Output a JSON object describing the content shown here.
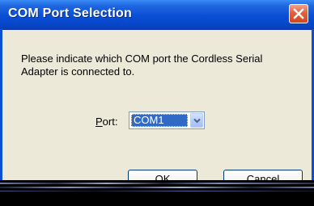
{
  "dialog": {
    "title": "COM Port Selection",
    "message": "Please indicate which COM port the Cordless Serial Adapter is connected to.",
    "port_label_mnemonic": "P",
    "port_label_rest": "ort:",
    "port_value": "COM1",
    "ok_label": "OK",
    "cancel_label": "Cancel"
  },
  "colors": {
    "titlebar": "#0a4fd4",
    "dialog_background": "#ece9d8",
    "selection": "#316ac5",
    "close_button": "#e2603d"
  },
  "icons": {
    "close": "close-icon",
    "dropdown": "chevron-down-icon"
  }
}
